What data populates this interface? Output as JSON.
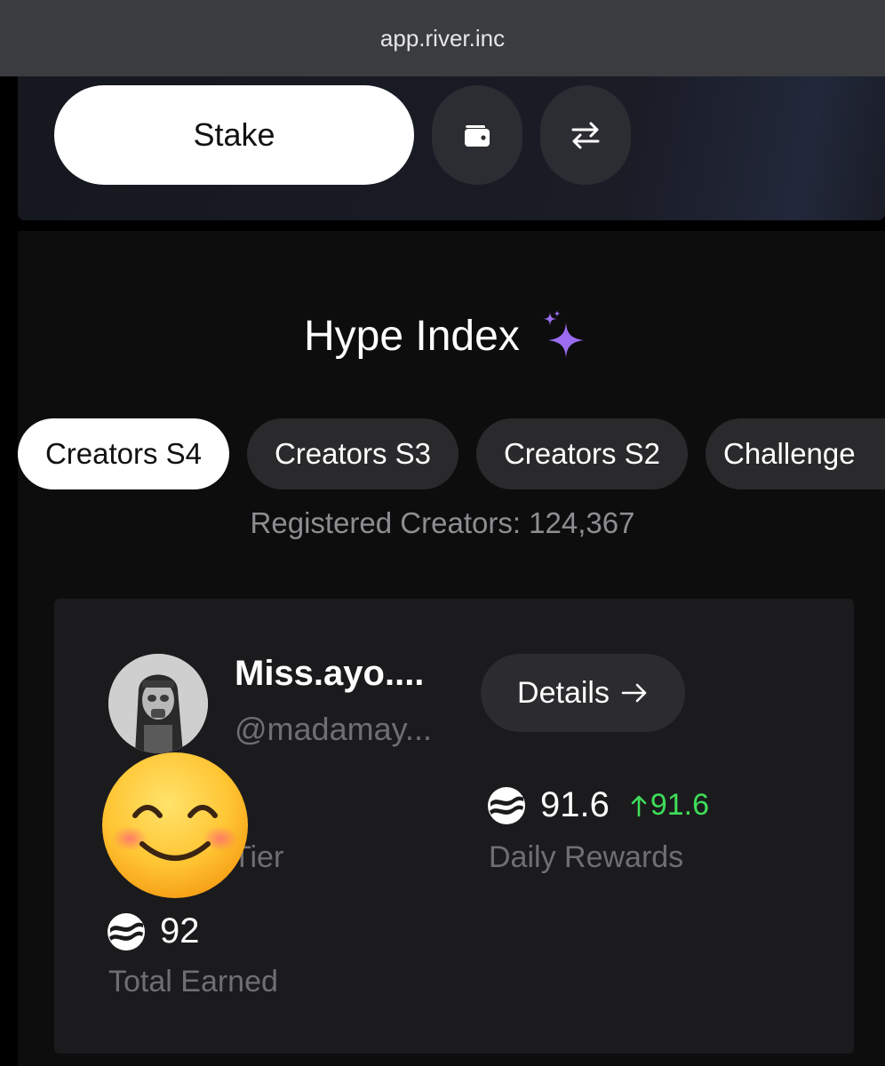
{
  "browser": {
    "url": "app.river.inc"
  },
  "actions": {
    "stake_label": "Stake",
    "wallet_icon": "wallet-icon",
    "swap_icon": "swap-arrows-icon"
  },
  "hype": {
    "title": "Hype Index",
    "title_icon": "sparkles-icon",
    "accent": "#9b6cf2"
  },
  "tabs": [
    {
      "label": "Creators S4",
      "active": true
    },
    {
      "label": "Creators S3",
      "active": false
    },
    {
      "label": "Creators S2",
      "active": false
    },
    {
      "label": "Challenge",
      "active": false
    }
  ],
  "registered_text": "Registered Creators: 124,367",
  "creator": {
    "name": "Miss.ayo....",
    "handle": "@madamay...",
    "details_label": "Details",
    "details_icon": "arrow-right-icon",
    "tier_label": "Tier",
    "daily_value": "91.6",
    "daily_change": "91.6",
    "daily_change_color": "#3fdd5a",
    "daily_label": "Daily Rewards",
    "total_value": "92",
    "total_label": "Total Earned",
    "token_icon": "river-token-icon"
  }
}
